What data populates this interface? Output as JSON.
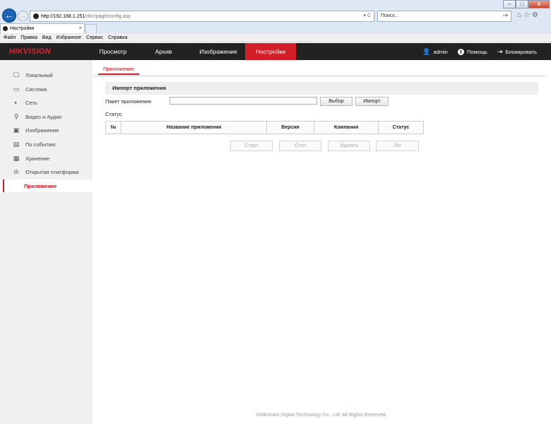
{
  "browser": {
    "window_controls": {
      "minimize": "–",
      "maximize": "□",
      "close": "x"
    },
    "back_icon": "←",
    "forward_icon": "→",
    "url_host": "http://192.168.1.251",
    "url_path": "/doc/page/config.asp",
    "address_tools": "▾ C",
    "search_placeholder": "Поиск...",
    "search_icon": "⌕▾",
    "toolbar_icons": "⌂☆⚙",
    "tab_title": "Настройки",
    "tab_close": "×",
    "menu": [
      "Файл",
      "Правка",
      "Вид",
      "Избранное",
      "Сервис",
      "Справка"
    ]
  },
  "header": {
    "logo": "HIKVISION",
    "nav": [
      {
        "label": "Просмотр",
        "active": false
      },
      {
        "label": "Архив",
        "active": false
      },
      {
        "label": "Изображение",
        "active": false
      },
      {
        "label": "Настройки",
        "active": true
      }
    ],
    "user": "admin",
    "help": "Помощь",
    "logout": "Блокировать",
    "user_icon": "person-icon",
    "help_icon": "info-icon",
    "logout_icon": "logout-icon",
    "accent_color": "#d21e26"
  },
  "sidebar": {
    "items": [
      {
        "label": "Локальный",
        "icon": "monitor-icon",
        "glyph": "🖵"
      },
      {
        "label": "Система",
        "icon": "system-icon",
        "glyph": "▭"
      },
      {
        "label": "Сеть",
        "icon": "globe-icon",
        "glyph": "◐"
      },
      {
        "label": "Видео и Аудио",
        "icon": "microphone-icon",
        "glyph": "⚲"
      },
      {
        "label": "Изображение",
        "icon": "image-icon",
        "glyph": "▣"
      },
      {
        "label": "По событию",
        "icon": "calendar-icon",
        "glyph": "▤"
      },
      {
        "label": "Хранение",
        "icon": "storage-icon",
        "glyph": "▦"
      },
      {
        "label": "Открытая платформа",
        "icon": "chart-icon",
        "glyph": "ılı"
      },
      {
        "label": "Приложение",
        "icon": "",
        "glyph": "",
        "active": true
      }
    ]
  },
  "main": {
    "subtab": "Приложение",
    "section_title": "Импорт приложения",
    "package_label": "Пакет приложения",
    "package_value": "",
    "browse_button": "Выбор",
    "import_button": "Импорт",
    "status_label": "Статус",
    "table_headers": [
      "№",
      "Название приложения",
      "Версия",
      "Компания",
      "Статус"
    ],
    "actions": [
      "Старт",
      "Стоп",
      "Удалить",
      "Лог"
    ]
  },
  "footer": "©Hikvision Digital Technology Co., Ltd. All Rights Reserved."
}
